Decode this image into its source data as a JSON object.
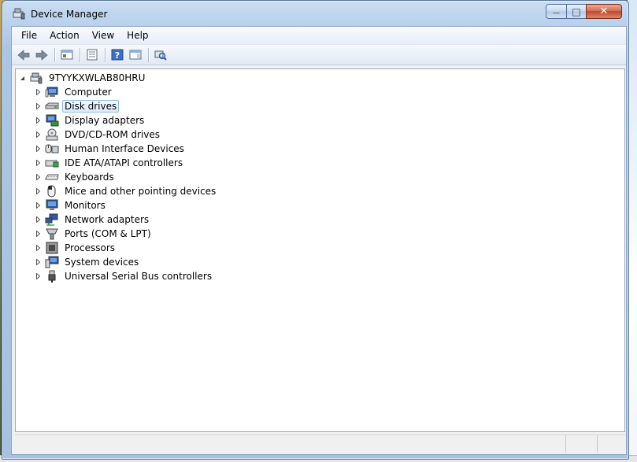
{
  "window": {
    "title": "Device Manager",
    "caption": {
      "minimize": "—",
      "maximize": "□",
      "close": "✕"
    }
  },
  "menubar": {
    "items": [
      "File",
      "Action",
      "View",
      "Help"
    ]
  },
  "toolbar": {
    "buttons": [
      "back-icon",
      "forward-icon",
      "show-hide-tree-icon",
      "properties-icon",
      "help-icon",
      "action-pane-icon",
      "scan-hardware-icon"
    ]
  },
  "tree": {
    "root": {
      "label": "9TYYKXWLAB80HRU",
      "icon": "computer-root-icon",
      "expanded": true
    },
    "categories": [
      {
        "label": "Computer",
        "icon": "computer-icon"
      },
      {
        "label": "Disk drives",
        "icon": "disk-drive-icon",
        "selected": true
      },
      {
        "label": "Display adapters",
        "icon": "display-adapter-icon"
      },
      {
        "label": "DVD/CD-ROM drives",
        "icon": "dvd-drive-icon"
      },
      {
        "label": "Human Interface Devices",
        "icon": "hid-icon"
      },
      {
        "label": "IDE ATA/ATAPI controllers",
        "icon": "ide-controller-icon"
      },
      {
        "label": "Keyboards",
        "icon": "keyboard-icon"
      },
      {
        "label": "Mice and other pointing devices",
        "icon": "mouse-icon"
      },
      {
        "label": "Monitors",
        "icon": "monitor-icon"
      },
      {
        "label": "Network adapters",
        "icon": "network-adapter-icon"
      },
      {
        "label": "Ports (COM & LPT)",
        "icon": "port-icon"
      },
      {
        "label": "Processors",
        "icon": "processor-icon"
      },
      {
        "label": "System devices",
        "icon": "system-device-icon"
      },
      {
        "label": "Universal Serial Bus controllers",
        "icon": "usb-icon"
      }
    ]
  },
  "colors": {
    "selection_border": "#8fbbe6",
    "frame": "#a6c2e2",
    "close_button": "#c0472a"
  }
}
